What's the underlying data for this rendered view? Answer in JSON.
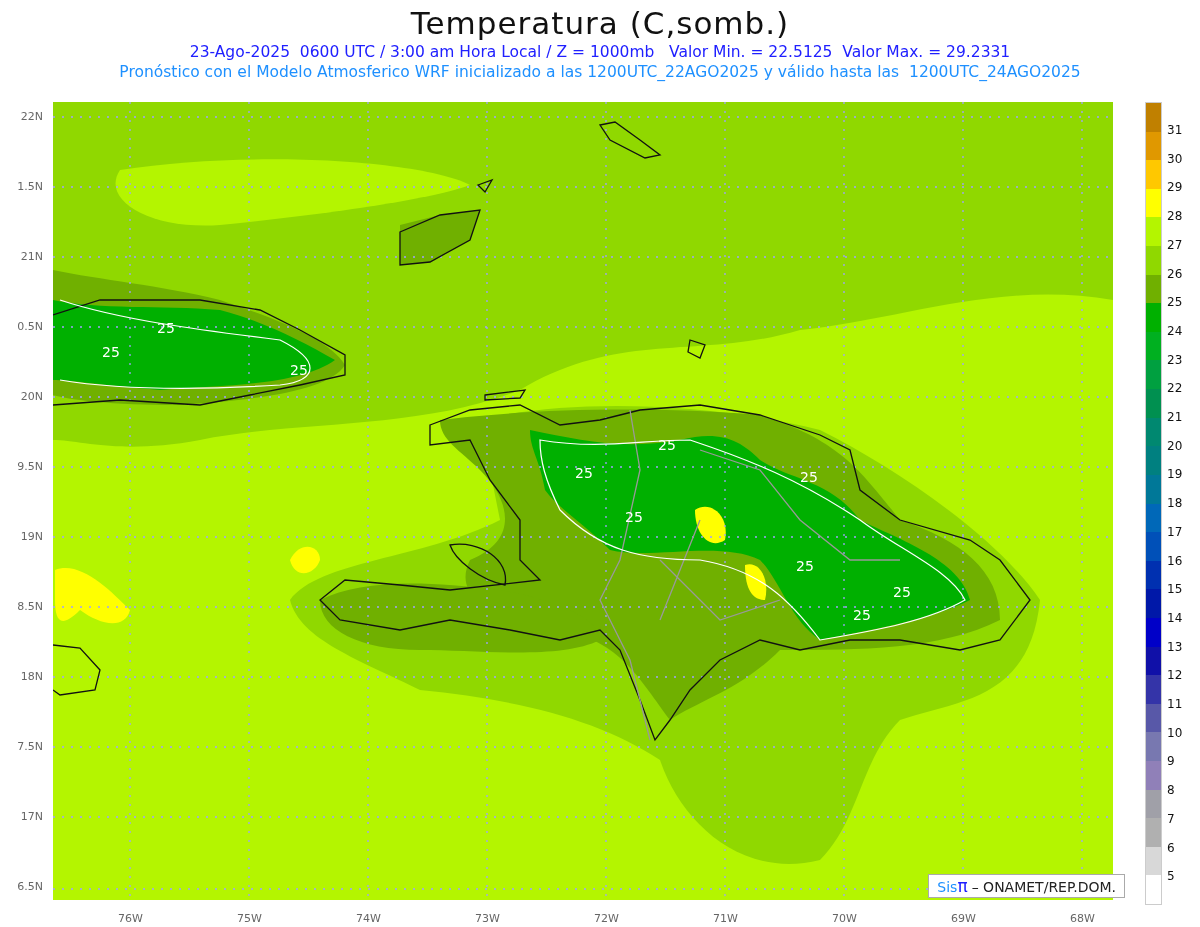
{
  "title": "Temperatura (C,somb.)",
  "subtitle_lines": [
    "23-Ago-2025  0600 UTC / 3:00 am Hora Local / Z = 1000mb   Valor Min. = 22.5125  Valor Max. = 29.2331",
    "Pronóstico con el Modelo Atmosferico WRF inicializado a las 1200UTC_22AGO2025 y válido hasta las  1200UTC_24AGO2025"
  ],
  "latitude_labels": [
    "22N",
    "1.5N",
    "21N",
    "0.5N",
    "20N",
    "9.5N",
    "19N",
    "8.5N",
    "18N",
    "7.5N",
    "17N",
    "6.5N"
  ],
  "longitude_labels": [
    "76W",
    "75W",
    "74W",
    "73W",
    "72W",
    "71W",
    "70W",
    "69W",
    "68W"
  ],
  "contour_labels": [
    "25",
    "25",
    "25",
    "25",
    "25",
    "25",
    "25",
    "25",
    "25",
    "25"
  ],
  "credit": {
    "logo_text": "Sis",
    "logo_symbol": "π",
    "text": "– ONAMET/REP.DOM."
  },
  "colorbar": {
    "segments": [
      {
        "color": "#c08000"
      },
      {
        "color": "#e09800"
      },
      {
        "color": "#ffc800"
      },
      {
        "color": "#ffff00"
      },
      {
        "color": "#b4f500"
      },
      {
        "color": "#90d800"
      },
      {
        "color": "#70b000"
      },
      {
        "color": "#00b000"
      },
      {
        "color": "#00b020"
      },
      {
        "color": "#00a040"
      },
      {
        "color": "#009050"
      },
      {
        "color": "#008870"
      },
      {
        "color": "#008080"
      },
      {
        "color": "#007898"
      },
      {
        "color": "#0068b8"
      },
      {
        "color": "#0050b8"
      },
      {
        "color": "#0030b0"
      },
      {
        "color": "#0018a8"
      },
      {
        "color": "#0000c8"
      },
      {
        "color": "#1010a8"
      },
      {
        "color": "#3434a8"
      },
      {
        "color": "#5858a8"
      },
      {
        "color": "#7878b0"
      },
      {
        "color": "#9080b8"
      },
      {
        "color": "#a0a0a8"
      },
      {
        "color": "#b0b0b0"
      },
      {
        "color": "#d8d8d8"
      }
    ],
    "labels": [
      "31",
      "30",
      "29",
      "28",
      "27",
      "26",
      "25",
      "24",
      "23",
      "22",
      "21",
      "20",
      "19",
      "18",
      "17",
      "16",
      "15",
      "14",
      "13",
      "12",
      "11",
      "10",
      "9",
      "8",
      "7",
      "6",
      "5"
    ]
  }
}
